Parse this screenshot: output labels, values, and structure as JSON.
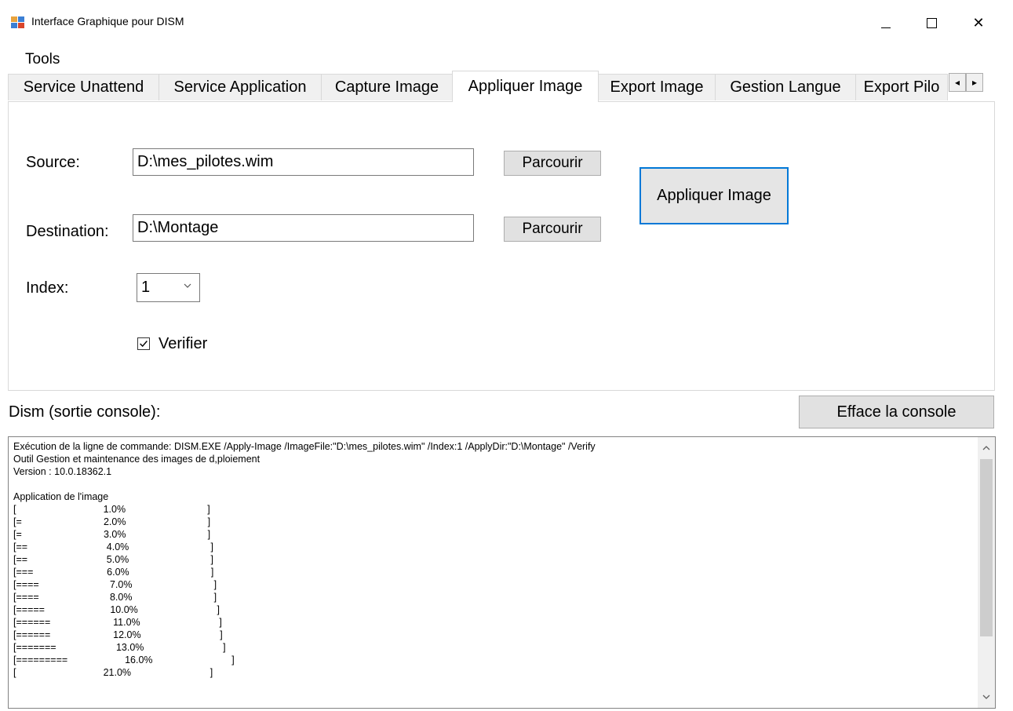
{
  "window": {
    "title": "Interface Graphique pour DISM",
    "controls": {
      "minimize": "minimize",
      "maximize": "maximize",
      "close": "✕"
    }
  },
  "menu": {
    "tools": "Tools"
  },
  "tabs": [
    {
      "label": "Service Unattend",
      "active": false
    },
    {
      "label": "Service Application",
      "active": false
    },
    {
      "label": "Capture Image",
      "active": false
    },
    {
      "label": "Appliquer Image",
      "active": true
    },
    {
      "label": "Export Image",
      "active": false
    },
    {
      "label": "Gestion Langue",
      "active": false
    },
    {
      "label": "Export Pilo",
      "active": false
    }
  ],
  "tab_scroll": {
    "left": "◂",
    "right": "▸"
  },
  "form": {
    "source_label": "Source:",
    "source_value": "D:\\mes_pilotes.wim",
    "destination_label": "Destination:",
    "destination_value": "D:\\Montage",
    "browse_label": "Parcourir",
    "apply_label": "Appliquer Image",
    "index_label": "Index:",
    "index_value": "1",
    "verify_label": "Verifier",
    "verify_checked": true
  },
  "console": {
    "label": "Dism (sortie console):",
    "clear_label": "Efface la console",
    "lines": [
      "Exécution de la ligne de commande: DISM.EXE /Apply-Image /ImageFile:\"D:\\mes_pilotes.wim\" /Index:1 /ApplyDir:\"D:\\Montage\" /Verify",
      "Outil Gestion et maintenance des images de d,ploiement",
      "Version : 10.0.18362.1",
      "",
      "Application de l'image",
      "[                                1.0%                              ]",
      "[=                              2.0%                              ]",
      "[=                              3.0%                              ]",
      "[==                             4.0%                              ]",
      "[==                             5.0%                              ]",
      "[===                           6.0%                              ]",
      "[====                          7.0%                              ]",
      "[====                          8.0%                              ]",
      "[=====                        10.0%                             ]",
      "[======                       11.0%                             ]",
      "[======                       12.0%                             ]",
      "[=======                      13.0%                             ]",
      "[=========                     16.0%                             ]",
      "[                                21.0%                             ]"
    ]
  },
  "icons": {
    "app": "dism-app-icon",
    "chevron": "chevron-down-icon",
    "scroll_up": "scroll-up-icon",
    "scroll_down": "scroll-down-icon"
  },
  "colors": {
    "focus_border": "#0078d7",
    "button_bg": "#e1e1e1",
    "tab_bg": "#f0f0f0"
  }
}
